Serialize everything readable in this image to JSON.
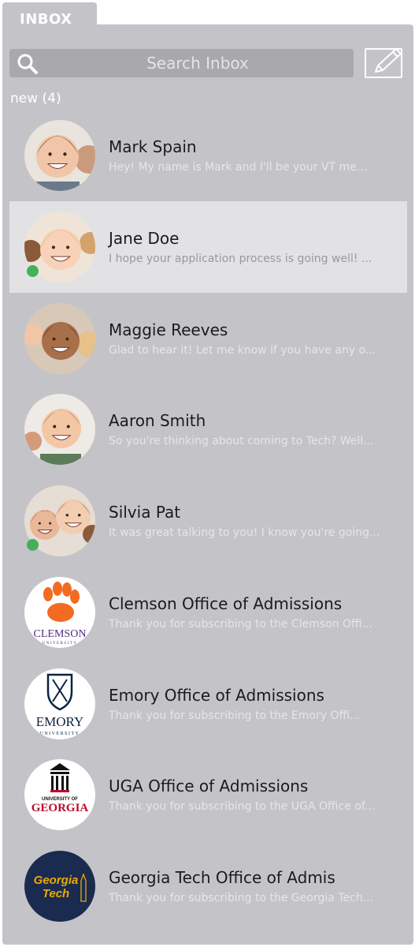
{
  "tab": {
    "label": "INBOX"
  },
  "search": {
    "placeholder": "Search Inbox"
  },
  "new_label": "new (4)",
  "messages": [
    {
      "name": "Mark Spain",
      "preview": "Hey! My name is Mark and I'll be your VT me...",
      "online": false,
      "selected": false,
      "avatar": "photo-young-man"
    },
    {
      "name": "Jane Doe",
      "preview": "I hope your application process is going well! ...",
      "online": true,
      "selected": true,
      "avatar": "photo-blonde-girl"
    },
    {
      "name": "Maggie Reeves",
      "preview": "Glad to hear it! Let me know if you have any o...",
      "online": false,
      "selected": false,
      "avatar": "photo-smiling-girl"
    },
    {
      "name": "Aaron Smith",
      "preview": "So you're thinking about coming to Tech? Well...",
      "online": false,
      "selected": false,
      "avatar": "photo-young-man-2"
    },
    {
      "name": "Silvia Pat",
      "preview": "It was great talking to you! I know you're going...",
      "online": true,
      "selected": false,
      "avatar": "photo-friends"
    },
    {
      "name": "Clemson Office of Admissions",
      "preview": "Thank you for subscribing to the Clemson Offi...",
      "online": false,
      "selected": false,
      "avatar": "clemson-logo",
      "logo_text": "CLEMSON",
      "logo_sub": "UNIVERSITY"
    },
    {
      "name": "Emory Office of Admissions",
      "preview": "Thank you for subscribing to the Emory Offi...",
      "online": false,
      "selected": false,
      "avatar": "emory-logo",
      "logo_text": "EMORY",
      "logo_sub": "UNIVERSITY"
    },
    {
      "name": "UGA Office of Admissions",
      "preview": "Thank you for subscribing to the UGA Office of...",
      "online": false,
      "selected": false,
      "avatar": "uga-logo",
      "logo_text": "GEORGIA",
      "logo_sub": "UNIVERSITY OF"
    },
    {
      "name": "Georgia Tech Office of Admis",
      "preview": "Thank you for subscribing to the Georgia Tech...",
      "online": false,
      "selected": false,
      "avatar": "georgia-tech-logo",
      "logo_text": "Georgia",
      "logo_sub": "Tech"
    }
  ],
  "colors": {
    "panel": "#c4c4c8",
    "search": "#a9a9ad",
    "selected_row": "#e2e2e4",
    "online_dot": "#44b05a",
    "clemson_orange": "#f26b21",
    "clemson_purple": "#522d80",
    "emory_blue": "#0c2340",
    "uga_red": "#ba0c2f",
    "gt_navy": "#1b2b4f",
    "gt_gold": "#eaaa00"
  }
}
